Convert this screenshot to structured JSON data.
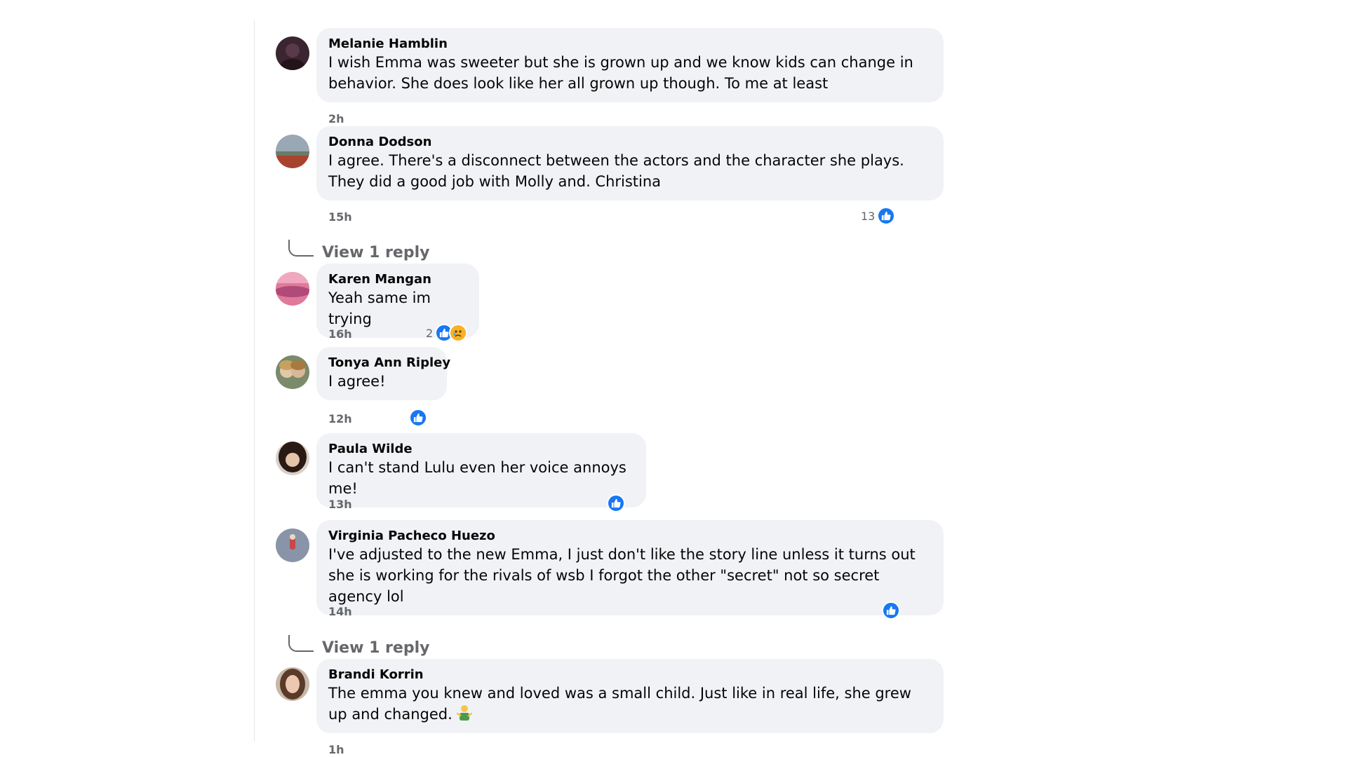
{
  "comments": [
    {
      "author": "Melanie Hamblin",
      "text": "I wish Emma was sweeter but she is grown up and we know kids can change in behavior. She does look like her all grown up though. To me at least",
      "time": "2h"
    },
    {
      "author": "Donna Dodson",
      "text": "I agree. There's a disconnect between the actors and the character she plays. They did a good job with Molly and. Christina",
      "time": "15h",
      "reaction_count": "13",
      "reply_link": "View 1 reply"
    },
    {
      "author": "Karen Mangan",
      "text": "Yeah same im trying",
      "time": "16h",
      "reaction_count": "2"
    },
    {
      "author": "Tonya Ann Ripley",
      "text": "I agree!",
      "time": "12h"
    },
    {
      "author": "Paula Wilde",
      "text": "I can't stand Lulu even her voice annoys me!",
      "time": "13h"
    },
    {
      "author": "Virginia Pacheco Huezo",
      "text": "I've adjusted to the new Emma, I just don't like the story line unless it turns out she is working for the rivals of wsb I forgot the other \"secret\" not so secret agency lol",
      "time": "14h",
      "reply_link": "View 1 reply"
    },
    {
      "author": "Brandi Korrin",
      "text": "The emma you knew and loved was a small child. Just like in real life, she grew up and changed.",
      "time": "1h"
    }
  ],
  "icons": {
    "like": "like-reaction-icon",
    "sad": "sad-reaction-icon",
    "emoji": "person-shrugging-emoji"
  },
  "colors": {
    "like": "#1877f2",
    "bubble": "#f0f2f5",
    "meta": "#65676b"
  }
}
